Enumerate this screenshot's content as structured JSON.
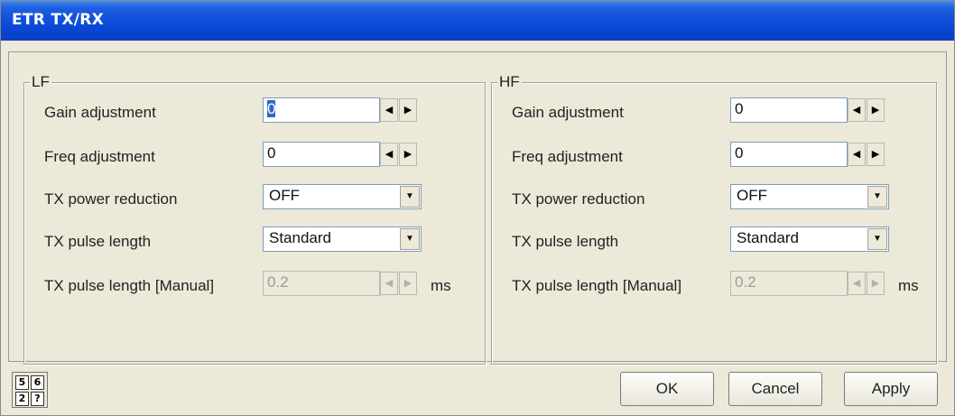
{
  "window": {
    "title": "ETR TX/RX"
  },
  "groups": [
    {
      "title": "LF",
      "gain": {
        "label": "Gain adjustment",
        "value": "0"
      },
      "freq": {
        "label": "Freq adjustment",
        "value": "0"
      },
      "power": {
        "label": "TX power reduction",
        "value": "OFF"
      },
      "pulse": {
        "label": "TX pulse length",
        "value": "Standard"
      },
      "manual": {
        "label": "TX pulse length [Manual]",
        "value": "0.2",
        "unit": "ms"
      }
    },
    {
      "title": "HF",
      "gain": {
        "label": "Gain adjustment",
        "value": "0"
      },
      "freq": {
        "label": "Freq adjustment",
        "value": "0"
      },
      "power": {
        "label": "TX power reduction",
        "value": "OFF"
      },
      "pulse": {
        "label": "TX pulse length",
        "value": "Standard"
      },
      "manual": {
        "label": "TX pulse length [Manual]",
        "value": "0.2",
        "unit": "ms"
      }
    }
  ],
  "footer": {
    "help_icon_digits": [
      "5",
      "6",
      "2",
      "?"
    ],
    "ok_label": "OK",
    "cancel_label": "Cancel",
    "apply_label": "Apply"
  },
  "icons": {
    "spin_left": "arrow-left-icon",
    "spin_right": "arrow-right-icon",
    "dropdown": "chevron-down-icon",
    "help": "help-grid-icon"
  }
}
